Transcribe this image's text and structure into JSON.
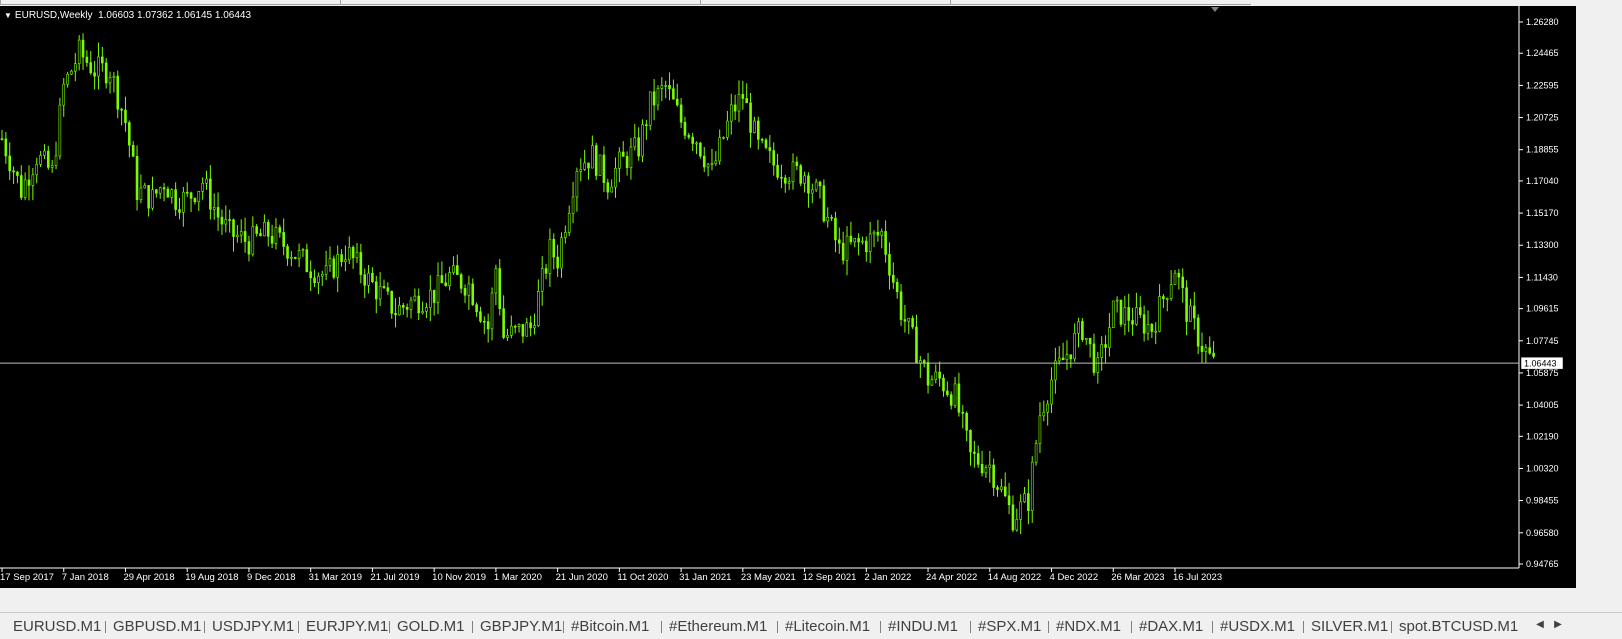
{
  "chart_header": {
    "symbol": "EURUSD,Weekly",
    "ohlc": "1.06603 1.07362 1.06145 1.06443"
  },
  "chart_data": {
    "type": "candlestick",
    "symbol": "EURUSD",
    "timeframe": "Weekly",
    "y_ticks": [
      "1.26280",
      "1.24465",
      "1.22595",
      "1.20725",
      "1.18855",
      "1.17040",
      "1.15170",
      "1.13300",
      "1.11430",
      "1.09615",
      "1.07745",
      "1.05875",
      "1.04005",
      "1.02190",
      "1.00320",
      "0.98455",
      "0.96580",
      "0.94765"
    ],
    "ylim": [
      0.94765,
      1.2628
    ],
    "x_ticks": [
      "17 Sep 2017",
      "7 Jan 2018",
      "29 Apr 2018",
      "19 Aug 2018",
      "9 Dec 2018",
      "31 Mar 2019",
      "21 Jul 2019",
      "10 Nov 2019",
      "1 Mar 2020",
      "21 Jun 2020",
      "11 Oct 2020",
      "31 Jan 2021",
      "23 May 2021",
      "12 Sep 2021",
      "2 Jan 2022",
      "24 Apr 2022",
      "14 Aug 2022",
      "4 Dec 2022",
      "26 Mar 2023",
      "16 Jul 2023"
    ],
    "current_price": "1.06443",
    "price_path": [
      [
        "17 Sep 2017",
        1.195
      ],
      [
        "22 Oct 2017",
        1.165
      ],
      [
        "19 Nov 2017",
        1.185
      ],
      [
        "17 Dec 2017",
        1.175
      ],
      [
        "7 Jan 2018",
        1.225
      ],
      [
        "4 Feb 2018",
        1.245
      ],
      [
        "4 Mar 2018",
        1.235
      ],
      [
        "1 Apr 2018",
        1.235
      ],
      [
        "29 Apr 2018",
        1.205
      ],
      [
        "20 May 2018",
        1.165
      ],
      [
        "17 Jun 2018",
        1.16
      ],
      [
        "8 Jul 2018",
        1.17
      ],
      [
        "29 Jul 2018",
        1.16
      ],
      [
        "19 Aug 2018",
        1.16
      ],
      [
        "16 Sep 2018",
        1.17
      ],
      [
        "14 Oct 2018",
        1.15
      ],
      [
        "4 Nov 2018",
        1.14
      ],
      [
        "9 Dec 2018",
        1.135
      ],
      [
        "13 Jan 2019",
        1.14
      ],
      [
        "17 Feb 2019",
        1.132
      ],
      [
        "31 Mar 2019",
        1.12
      ],
      [
        "28 Apr 2019",
        1.115
      ],
      [
        "2 Jun 2019",
        1.13
      ],
      [
        "21 Jul 2019",
        1.11
      ],
      [
        "1 Sep 2019",
        1.095
      ],
      [
        "29 Sep 2019",
        1.1
      ],
      [
        "10 Nov 2019",
        1.105
      ],
      [
        "8 Dec 2019",
        1.115
      ],
      [
        "12 Jan 2020",
        1.11
      ],
      [
        "16 Feb 2020",
        1.085
      ],
      [
        "1 Mar 2020",
        1.12
      ],
      [
        "15 Mar 2020",
        1.08
      ],
      [
        "3 May 2020",
        1.085
      ],
      [
        "7 Jun 2020",
        1.13
      ],
      [
        "21 Jun 2020",
        1.125
      ],
      [
        "26 Jul 2020",
        1.18
      ],
      [
        "23 Aug 2020",
        1.185
      ],
      [
        "20 Sep 2020",
        1.17
      ],
      [
        "11 Oct 2020",
        1.18
      ],
      [
        "15 Nov 2020",
        1.19
      ],
      [
        "6 Dec 2020",
        1.215
      ],
      [
        "3 Jan 2021",
        1.225
      ],
      [
        "31 Jan 2021",
        1.205
      ],
      [
        "28 Feb 2021",
        1.195
      ],
      [
        "28 Mar 2021",
        1.175
      ],
      [
        "2 May 2021",
        1.21
      ],
      [
        "23 May 2021",
        1.22
      ],
      [
        "20 Jun 2021",
        1.19
      ],
      [
        "18 Jul 2021",
        1.18
      ],
      [
        "22 Aug 2021",
        1.175
      ],
      [
        "12 Sep 2021",
        1.175
      ],
      [
        "10 Oct 2021",
        1.16
      ],
      [
        "14 Nov 2021",
        1.13
      ],
      [
        "2 Jan 2022",
        1.135
      ],
      [
        "30 Jan 2022",
        1.14
      ],
      [
        "6 Mar 2022",
        1.095
      ],
      [
        "24 Apr 2022",
        1.055
      ],
      [
        "15 May 2022",
        1.055
      ],
      [
        "12 Jun 2022",
        1.045
      ],
      [
        "10 Jul 2022",
        1.01
      ],
      [
        "14 Aug 2022",
        1.005
      ],
      [
        "25 Sep 2022",
        0.975
      ],
      [
        "23 Oct 2022",
        0.985
      ],
      [
        "13 Nov 2022",
        1.035
      ],
      [
        "4 Dec 2022",
        1.055
      ],
      [
        "29 Jan 2023",
        1.085
      ],
      [
        "26 Feb 2023",
        1.06
      ],
      [
        "26 Mar 2023",
        1.095
      ],
      [
        "7 May 2023",
        1.09
      ],
      [
        "4 Jun 2023",
        1.085
      ],
      [
        "16 Jul 2023",
        1.12
      ],
      [
        "6 Aug 2023",
        1.095
      ],
      [
        "3 Sep 2023",
        1.075
      ],
      [
        "24 Sep 2023",
        1.064
      ]
    ]
  },
  "tabs": [
    {
      "label": "EURUSD.M1"
    },
    {
      "label": "GBPUSD.M1"
    },
    {
      "label": "USDJPY.M1"
    },
    {
      "label": "EURJPY.M1"
    },
    {
      "label": "GOLD.M1"
    },
    {
      "label": "GBPJPY.M1"
    },
    {
      "label": "#Bitcoin.M1"
    },
    {
      "label": "#Ethereum.M1"
    },
    {
      "label": "#Litecoin.M1"
    },
    {
      "label": "#INDU.M1"
    },
    {
      "label": "#SPX.M1"
    },
    {
      "label": "#NDX.M1"
    },
    {
      "label": "#DAX.M1"
    },
    {
      "label": "#USDX.M1"
    },
    {
      "label": "SILVER.M1"
    },
    {
      "label": "spot.BTCUSD.M1"
    }
  ],
  "icons": {
    "scroll_left": "chevron-left-icon",
    "scroll_right": "chevron-right-icon",
    "dropdown": "triangle-down-icon"
  },
  "colors": {
    "background": "#000000",
    "candle": "#7CFC00",
    "price_line": "#c0c0c0",
    "axis_text": "#ffffff"
  }
}
